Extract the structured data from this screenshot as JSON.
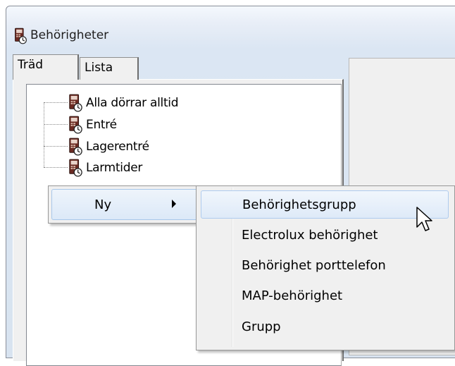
{
  "window": {
    "title": "Behörigheter",
    "title_icon": "door-access-icon"
  },
  "tabs": [
    {
      "label": "Träd",
      "active": true
    },
    {
      "label": "Lista",
      "active": false
    }
  ],
  "tree": {
    "items": [
      {
        "label": "Alla dörrar alltid",
        "icon": "door-access-icon"
      },
      {
        "label": "Entré",
        "icon": "door-access-icon"
      },
      {
        "label": "Lagerentré",
        "icon": "door-access-icon"
      },
      {
        "label": "Larmtider",
        "icon": "door-access-icon"
      }
    ]
  },
  "context_menu": {
    "item": {
      "label": "Ny",
      "has_submenu": true
    }
  },
  "submenu": {
    "items": [
      {
        "label": "Behörighetsgrupp",
        "hovered": true
      },
      {
        "label": "Electrolux behörighet"
      },
      {
        "label": "Behörighet porttelefon"
      },
      {
        "label": "MAP-behörighet"
      },
      {
        "label": "Grupp"
      }
    ]
  },
  "colors": {
    "hover_border": "#aecbee",
    "hover_fill": "#deeaf8",
    "menu_bg": "#f0f0f0"
  }
}
